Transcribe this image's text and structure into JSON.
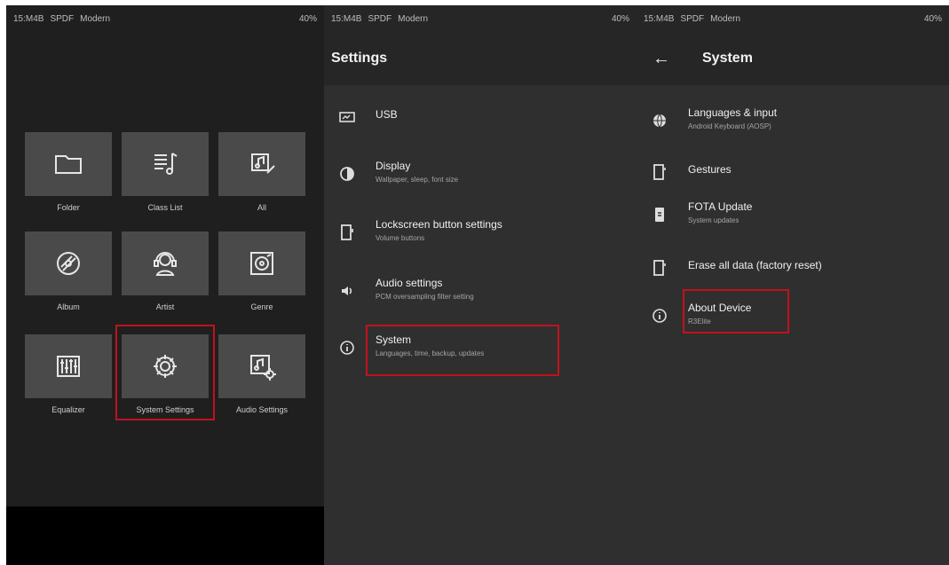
{
  "status_bar": {
    "time": "15:M4B",
    "spdf": "SPDF",
    "mode": "Modern",
    "battery": "40%"
  },
  "home": {
    "tiles": [
      {
        "label": "Folder",
        "icon": "folder-icon"
      },
      {
        "label": "Class List",
        "icon": "playlist-icon"
      },
      {
        "label": "All",
        "icon": "music-edit-icon"
      },
      {
        "label": "Album",
        "icon": "album-disc-icon"
      },
      {
        "label": "Artist",
        "icon": "artist-headphones-icon"
      },
      {
        "label": "Genre",
        "icon": "genre-icon"
      },
      {
        "label": "Equalizer",
        "icon": "equalizer-icon"
      },
      {
        "label": "System Settings",
        "icon": "gear-icon"
      },
      {
        "label": "Audio Settings",
        "icon": "audio-settings-icon"
      }
    ]
  },
  "settings": {
    "title": "Settings",
    "items": [
      {
        "title": "USB",
        "subtitle": "",
        "icon": "usb-icon"
      },
      {
        "title": "Display",
        "subtitle": "Wallpaper, sleep, font size",
        "icon": "display-icon"
      },
      {
        "title": "Lockscreen button settings",
        "subtitle": "Volume buttons",
        "icon": "lockscreen-icon"
      },
      {
        "title": "Audio settings",
        "subtitle": "PCM oversampling filter setting",
        "icon": "speaker-icon"
      },
      {
        "title": "System",
        "subtitle": "Languages, time, backup, updates",
        "icon": "info-icon"
      }
    ]
  },
  "system": {
    "title": "System",
    "items": [
      {
        "title": "Languages & input",
        "subtitle": "Android Keyboard (AOSP)",
        "icon": "globe-icon"
      },
      {
        "title": "Gestures",
        "subtitle": "",
        "icon": "gestures-icon"
      },
      {
        "title": "FOTA Update",
        "subtitle": "System updates",
        "icon": "fota-icon"
      },
      {
        "title": "Erase all data (factory reset)",
        "subtitle": "",
        "icon": "reset-icon"
      },
      {
        "title": "About Device",
        "subtitle": "R3Elite",
        "icon": "about-icon"
      }
    ]
  },
  "colors": {
    "highlight": "#c1121f",
    "tile": "#4a4a4a",
    "panel": "#2f2f2f"
  }
}
